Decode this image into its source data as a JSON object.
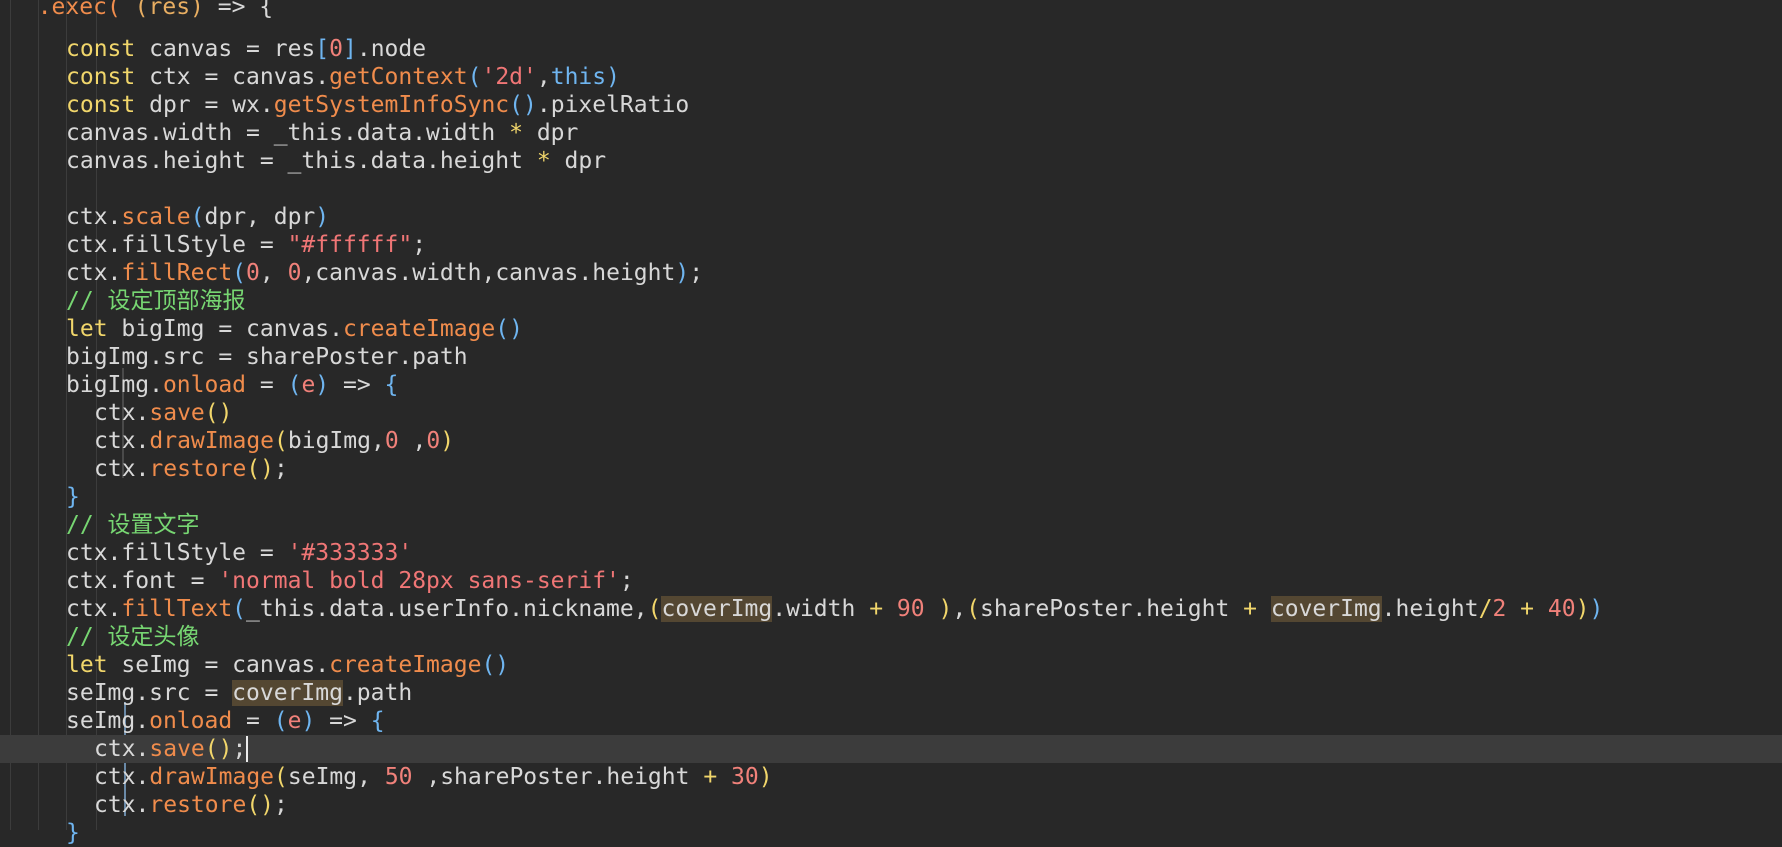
{
  "editor": {
    "lines": [
      {
        "indent": 0,
        "tokens": [
          {
            "t": "  ",
            "c": "o"
          },
          {
            "t": ".exec(",
            "c": "f"
          },
          {
            "t": " ",
            "c": "o"
          },
          {
            "t": "(res)",
            "c": "p"
          },
          {
            "t": " => {",
            "c": "o"
          }
        ]
      },
      {
        "indent": 4,
        "tokens": [
          {
            "t": "const",
            "c": "k"
          },
          {
            "t": " canvas = res",
            "c": "o"
          },
          {
            "t": "[",
            "c": "b"
          },
          {
            "t": "0",
            "c": "n"
          },
          {
            "t": "]",
            "c": "b"
          },
          {
            "t": ".node",
            "c": "o"
          }
        ]
      },
      {
        "indent": 4,
        "tokens": [
          {
            "t": "const",
            "c": "k"
          },
          {
            "t": " ctx = canvas.",
            "c": "o"
          },
          {
            "t": "getContext",
            "c": "f"
          },
          {
            "t": "(",
            "c": "b"
          },
          {
            "t": "'2d'",
            "c": "s"
          },
          {
            "t": ",",
            "c": "o"
          },
          {
            "t": "this",
            "c": "kb"
          },
          {
            "t": ")",
            "c": "b"
          }
        ]
      },
      {
        "indent": 4,
        "tokens": [
          {
            "t": "const",
            "c": "k"
          },
          {
            "t": " dpr = wx.",
            "c": "o"
          },
          {
            "t": "getSystemInfoSync",
            "c": "f"
          },
          {
            "t": "()",
            "c": "b"
          },
          {
            "t": ".pixelRatio",
            "c": "o"
          }
        ]
      },
      {
        "indent": 4,
        "tokens": [
          {
            "t": "canvas.width = _this.data.width ",
            "c": "o"
          },
          {
            "t": "*",
            "c": "k"
          },
          {
            "t": " dpr",
            "c": "o"
          }
        ]
      },
      {
        "indent": 4,
        "tokens": [
          {
            "t": "canvas.height = _this.data.height ",
            "c": "o"
          },
          {
            "t": "*",
            "c": "k"
          },
          {
            "t": " dpr",
            "c": "o"
          }
        ]
      },
      {
        "indent": 0,
        "tokens": []
      },
      {
        "indent": 4,
        "tokens": [
          {
            "t": "ctx.",
            "c": "o"
          },
          {
            "t": "scale",
            "c": "f"
          },
          {
            "t": "(",
            "c": "b"
          },
          {
            "t": "dpr, dpr",
            "c": "o"
          },
          {
            "t": ")",
            "c": "b"
          }
        ]
      },
      {
        "indent": 4,
        "tokens": [
          {
            "t": "ctx.fillStyle = ",
            "c": "o"
          },
          {
            "t": "\"#ffffff\"",
            "c": "s"
          },
          {
            "t": ";",
            "c": "o"
          }
        ]
      },
      {
        "indent": 4,
        "tokens": [
          {
            "t": "ctx.",
            "c": "o"
          },
          {
            "t": "fillRect",
            "c": "f"
          },
          {
            "t": "(",
            "c": "b"
          },
          {
            "t": "0",
            "c": "n"
          },
          {
            "t": ", ",
            "c": "o"
          },
          {
            "t": "0",
            "c": "n"
          },
          {
            "t": ",canvas.width,canvas.height",
            "c": "o"
          },
          {
            "t": ")",
            "c": "b"
          },
          {
            "t": ";",
            "c": "o"
          }
        ]
      },
      {
        "indent": 4,
        "tokens": [
          {
            "t": "// 设定顶部海报",
            "c": "c"
          }
        ]
      },
      {
        "indent": 4,
        "tokens": [
          {
            "t": "let",
            "c": "k"
          },
          {
            "t": " bigImg = canvas.",
            "c": "o"
          },
          {
            "t": "createImage",
            "c": "f"
          },
          {
            "t": "()",
            "c": "b"
          }
        ]
      },
      {
        "indent": 4,
        "tokens": [
          {
            "t": "bigImg.src = sharePoster.path",
            "c": "o"
          }
        ]
      },
      {
        "indent": 4,
        "tokens": [
          {
            "t": "bigImg.",
            "c": "o"
          },
          {
            "t": "onload",
            "c": "f"
          },
          {
            "t": " = ",
            "c": "o"
          },
          {
            "t": "(",
            "c": "b"
          },
          {
            "t": "e",
            "c": "n"
          },
          {
            "t": ")",
            "c": "b"
          },
          {
            "t": " => ",
            "c": "o"
          },
          {
            "t": "{",
            "c": "b"
          }
        ]
      },
      {
        "indent": 6,
        "tokens": [
          {
            "t": "ctx.",
            "c": "o"
          },
          {
            "t": "save",
            "c": "f"
          },
          {
            "t": "()",
            "c": "k"
          }
        ]
      },
      {
        "indent": 6,
        "tokens": [
          {
            "t": "ctx.",
            "c": "o"
          },
          {
            "t": "drawImage",
            "c": "f"
          },
          {
            "t": "(",
            "c": "k"
          },
          {
            "t": "bigImg,",
            "c": "o"
          },
          {
            "t": "0",
            "c": "n"
          },
          {
            "t": " ,",
            "c": "o"
          },
          {
            "t": "0",
            "c": "n"
          },
          {
            "t": ")",
            "c": "k"
          }
        ]
      },
      {
        "indent": 6,
        "tokens": [
          {
            "t": "ctx.",
            "c": "o"
          },
          {
            "t": "restore",
            "c": "f"
          },
          {
            "t": "()",
            "c": "k"
          },
          {
            "t": ";",
            "c": "o"
          }
        ]
      },
      {
        "indent": 4,
        "tokens": [
          {
            "t": "}",
            "c": "b"
          }
        ]
      },
      {
        "indent": 4,
        "tokens": [
          {
            "t": "// 设置文字",
            "c": "c"
          }
        ]
      },
      {
        "indent": 4,
        "tokens": [
          {
            "t": "ctx.fillStyle = ",
            "c": "o"
          },
          {
            "t": "'#333333'",
            "c": "s"
          }
        ]
      },
      {
        "indent": 4,
        "tokens": [
          {
            "t": "ctx.font = ",
            "c": "o"
          },
          {
            "t": "'normal bold 28px sans-serif'",
            "c": "s"
          },
          {
            "t": ";",
            "c": "o"
          }
        ]
      },
      {
        "indent": 4,
        "tokens": [
          {
            "t": "ctx.",
            "c": "o"
          },
          {
            "t": "fillText",
            "c": "f"
          },
          {
            "t": "(",
            "c": "b"
          },
          {
            "t": "_this.data.userInfo.nickname,",
            "c": "o"
          },
          {
            "t": "(",
            "c": "k"
          },
          {
            "t": "coverImg",
            "c": "o",
            "h": true
          },
          {
            "t": ".width ",
            "c": "o"
          },
          {
            "t": "+",
            "c": "k"
          },
          {
            "t": " ",
            "c": "o"
          },
          {
            "t": "90",
            "c": "n"
          },
          {
            "t": " ",
            "c": "o"
          },
          {
            "t": ")",
            "c": "k"
          },
          {
            "t": ",",
            "c": "o"
          },
          {
            "t": "(",
            "c": "k"
          },
          {
            "t": "sharePoster.height ",
            "c": "o"
          },
          {
            "t": "+",
            "c": "k"
          },
          {
            "t": " ",
            "c": "o"
          },
          {
            "t": "coverImg",
            "c": "o",
            "h": true
          },
          {
            "t": ".height",
            "c": "o"
          },
          {
            "t": "/",
            "c": "k"
          },
          {
            "t": "2",
            "c": "n"
          },
          {
            "t": " ",
            "c": "o"
          },
          {
            "t": "+",
            "c": "k"
          },
          {
            "t": " ",
            "c": "o"
          },
          {
            "t": "40",
            "c": "n"
          },
          {
            "t": ")",
            "c": "k"
          },
          {
            "t": ")",
            "c": "b"
          }
        ]
      },
      {
        "indent": 4,
        "tokens": [
          {
            "t": "// 设定头像",
            "c": "c"
          }
        ]
      },
      {
        "indent": 4,
        "tokens": [
          {
            "t": "let",
            "c": "k"
          },
          {
            "t": " seImg = canvas.",
            "c": "o"
          },
          {
            "t": "createImage",
            "c": "f"
          },
          {
            "t": "()",
            "c": "b"
          }
        ]
      },
      {
        "indent": 4,
        "tokens": [
          {
            "t": "seImg.src = ",
            "c": "o"
          },
          {
            "t": "coverImg",
            "c": "o",
            "h": true
          },
          {
            "t": ".path",
            "c": "o"
          }
        ]
      },
      {
        "indent": 4,
        "tokens": [
          {
            "t": "seImg.",
            "c": "o"
          },
          {
            "t": "onload",
            "c": "f"
          },
          {
            "t": " = ",
            "c": "o"
          },
          {
            "t": "(",
            "c": "b"
          },
          {
            "t": "e",
            "c": "n"
          },
          {
            "t": ")",
            "c": "b"
          },
          {
            "t": " => ",
            "c": "o"
          },
          {
            "t": "{",
            "c": "b"
          }
        ]
      },
      {
        "indent": 6,
        "current": true,
        "tokens": [
          {
            "t": "ctx.",
            "c": "o"
          },
          {
            "t": "save",
            "c": "f"
          },
          {
            "t": "()",
            "c": "k"
          },
          {
            "t": ";",
            "c": "o"
          }
        ]
      },
      {
        "indent": 6,
        "tokens": [
          {
            "t": "ctx.",
            "c": "o"
          },
          {
            "t": "drawImage",
            "c": "f"
          },
          {
            "t": "(",
            "c": "k"
          },
          {
            "t": "seImg, ",
            "c": "o"
          },
          {
            "t": "50",
            "c": "n"
          },
          {
            "t": " ,sharePoster.height ",
            "c": "o"
          },
          {
            "t": "+",
            "c": "k"
          },
          {
            "t": " ",
            "c": "o"
          },
          {
            "t": "30",
            "c": "n"
          },
          {
            "t": ")",
            "c": "k"
          }
        ]
      },
      {
        "indent": 6,
        "tokens": [
          {
            "t": "ctx.",
            "c": "o"
          },
          {
            "t": "restore",
            "c": "f"
          },
          {
            "t": "()",
            "c": "k"
          },
          {
            "t": ";",
            "c": "o"
          }
        ]
      },
      {
        "indent": 4,
        "tokens": [
          {
            "t": "}",
            "c": "b"
          }
        ]
      }
    ]
  }
}
